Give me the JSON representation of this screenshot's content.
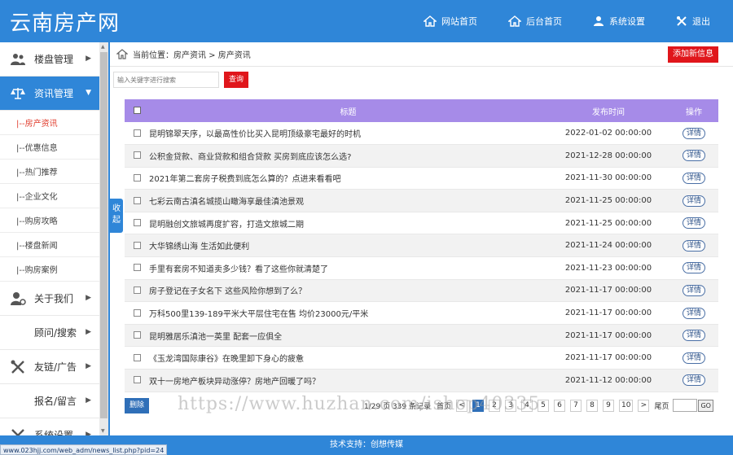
{
  "header": {
    "logo": "云南房产网",
    "nav": [
      {
        "label": "网站首页",
        "icon": "home-icon"
      },
      {
        "label": "后台首页",
        "icon": "home-icon"
      },
      {
        "label": "系统设置",
        "icon": "user-icon"
      },
      {
        "label": "退出",
        "icon": "tools-icon"
      }
    ]
  },
  "sidebar": {
    "groups": [
      {
        "label": "楼盘管理",
        "icon": "users-icon"
      },
      {
        "label": "资讯管理",
        "icon": "scales-icon"
      },
      {
        "label": "关于我们",
        "icon": "user-gear-icon"
      },
      {
        "label": "顾问/搜索"
      },
      {
        "label": "友链/广告",
        "icon": "tools-icon"
      },
      {
        "label": "报名/留言"
      },
      {
        "label": "系统设置",
        "icon": "tools-icon"
      }
    ],
    "subitems": [
      "|--房产资讯",
      "|--优惠信息",
      "|--热门推荐",
      "|--企业文化",
      "|--购房攻略",
      "|--楼盘新闻",
      "|--购房案例"
    ],
    "collapse_label": "收起"
  },
  "breadcrumb": "当前位置：房产资讯 > 房产资讯",
  "add_button": "添加新信息",
  "search": {
    "placeholder": "输入关键字进行搜索",
    "button": "查询"
  },
  "table": {
    "headers": {
      "title": "标题",
      "time": "发布时间",
      "op": "操作"
    },
    "detail_label": "详情",
    "rows": [
      {
        "title": "昆明锦翠天序，以最高性价比买入昆明顶级豪宅最好的时机",
        "time": "2022-01-02 00:00:00"
      },
      {
        "title": "公积金贷款、商业贷款和组合贷款 买房到底应该怎么选?",
        "time": "2021-12-28 00:00:00"
      },
      {
        "title": "2021年第二套房子税费到底怎么算的？点进来看看吧",
        "time": "2021-11-30 00:00:00"
      },
      {
        "title": "七彩云南古滇名城揽山瞰海享最佳滇池景观",
        "time": "2021-11-25 00:00:00"
      },
      {
        "title": "昆明融创文旅城再度扩容，打造文旅城二期",
        "time": "2021-11-25 00:00:00"
      },
      {
        "title": "大华锦绣山海 生活如此便利",
        "time": "2021-11-24 00:00:00"
      },
      {
        "title": "手里有套房不知道卖多少钱？看了这些你就清楚了",
        "time": "2021-11-23 00:00:00"
      },
      {
        "title": "房子登记在子女名下 这些风险你想到了么？",
        "time": "2021-11-17 00:00:00"
      },
      {
        "title": "万科500里139-189平米大平层住宅在售 均价23000元/平米",
        "time": "2021-11-17 00:00:00"
      },
      {
        "title": "昆明雅居乐滇池一英里 配套一应俱全",
        "time": "2021-11-17 00:00:00"
      },
      {
        "title": "《玉龙湾国际康谷》在晚里卸下身心的疲惫",
        "time": "2021-11-17 00:00:00"
      },
      {
        "title": "双十一房地产板块异动涨停？房地产回暖了吗？",
        "time": "2021-11-12 00:00:00"
      }
    ]
  },
  "footer_actions": {
    "delete": "删除"
  },
  "pager": {
    "info": "1/29 页 339 条记录",
    "first": "首页",
    "prev": "<",
    "pages": [
      "1",
      "2",
      "3",
      "4",
      "5",
      "6",
      "7",
      "8",
      "9",
      "10"
    ],
    "current": "1",
    "next": ">",
    "last": "尾页",
    "go": "GO"
  },
  "watermark": "https://www.huzhan.com/ishop40335",
  "footer": "技术支持：创想传媒",
  "statusbar": "www.023hjj.com/web_adm/news_list.php?pid=24",
  "colors": {
    "primary": "#2f86d8",
    "accent_red": "#e0161b",
    "table_header": "#a68be8"
  }
}
